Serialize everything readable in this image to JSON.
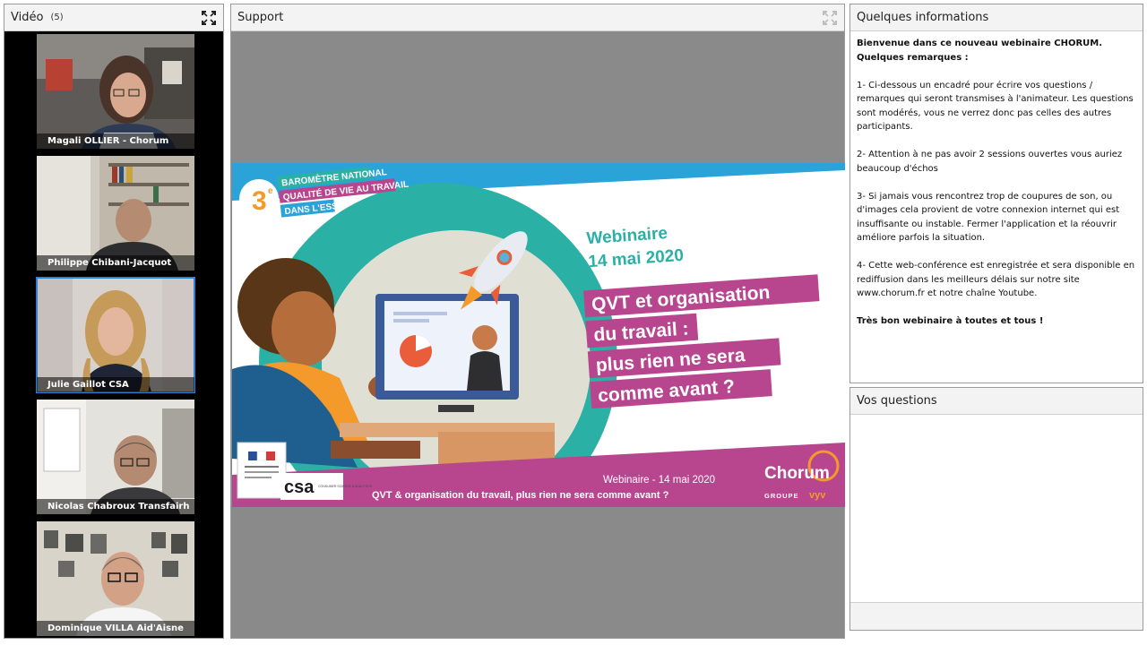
{
  "video": {
    "title": "Vidéo",
    "count": "(5)",
    "participants": [
      {
        "name": "Magali OLLIER - Chorum"
      },
      {
        "name": "Philippe Chibani-Jacquot"
      },
      {
        "name": "Julie Gaillot CSA"
      },
      {
        "name": "Nicolas Chabroux Transfairh"
      },
      {
        "name": "Dominique VILLA  Aid'Aisne"
      }
    ],
    "active_index": 2
  },
  "support": {
    "title": "Support",
    "slide": {
      "badge": "3",
      "badge_sup": "e",
      "barometre_lines": [
        "BAROMÈTRE NATIONAL",
        "QUALITÉ DE VIE AU TRAVAIL",
        "DANS L'ESS"
      ],
      "event": "Webinaire",
      "date": "14 mai 2020",
      "headline_lines": [
        "QVT et organisation",
        "du travail :",
        "plus rien ne sera",
        "comme avant ?"
      ],
      "footer_date": "Webinaire - 14 mai 2020",
      "footer_title": "QVT & organisation du travail, plus rien ne sera comme avant ?",
      "brand": "Chorum",
      "brand_group": "GROUPE",
      "brand_vyv": "vyv",
      "csa": "csa",
      "csa_sub": "CONSUMER SCIENCE & ANALYTICS"
    }
  },
  "info": {
    "title": "Quelques informations",
    "intro": "Bienvenue dans ce nouveau webinaire CHORUM. Quelques remarques :",
    "items": [
      "1- Ci-dessous un encadré pour écrire vos questions / remarques qui seront transmises à l'animateur. Les questions sont modérés, vous ne verrez donc pas celles des autres participants.",
      "2- Attention à ne pas avoir 2 sessions ouvertes vous auriez beaucoup d'échos",
      "3-  Si jamais vous rencontrez trop de coupures de son, ou d'images cela provient de votre connexion internet qui est insuffisante ou instable. Fermer l'application et la réouvrir améliore parfois la situation.",
      "4- Cette web-conférence est enregistrée et sera disponible en rediffusion dans les meilleurs délais sur notre site www.chorum.fr et notre chaîne Youtube."
    ],
    "closing": "Très bon webinaire à toutes et tous !"
  },
  "questions": {
    "title": "Vos questions",
    "placeholder": ""
  },
  "colors": {
    "accent_blue": "#2f7fd6",
    "slide_teal": "#2bb0a6",
    "slide_pink": "#b8468f",
    "slide_orange": "#f39a2b",
    "slide_top_blue": "#2aa3d8"
  },
  "icons": {
    "video_expand": "expand-icon",
    "support_expand": "expand-icon"
  }
}
